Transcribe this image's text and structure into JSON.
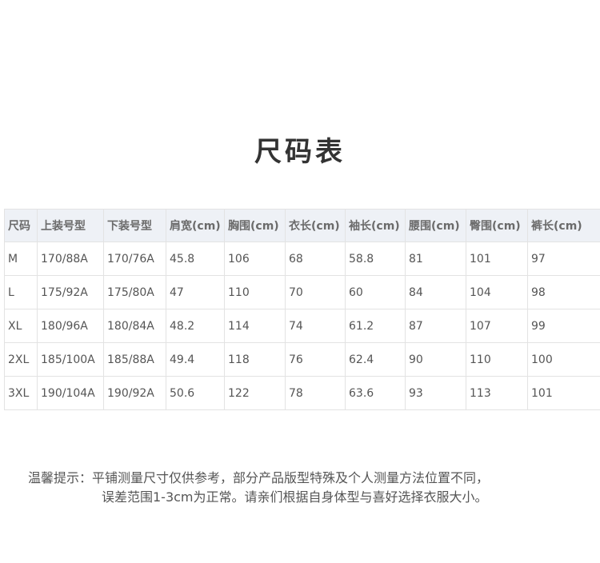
{
  "title": "尺码表",
  "table": {
    "headers": [
      "尺码",
      "上装号型",
      "下装号型",
      "肩宽(cm)",
      "胸围(cm)",
      "衣长(cm)",
      "袖长(cm)",
      "腰围(cm)",
      "臀围(cm)",
      "裤长(cm)"
    ],
    "rows": [
      [
        "M",
        "170/88A",
        "170/76A",
        "45.8",
        "106",
        "68",
        "58.8",
        "81",
        "101",
        "97"
      ],
      [
        "L",
        "175/92A",
        "175/80A",
        "47",
        "110",
        "70",
        "60",
        "84",
        "104",
        "98"
      ],
      [
        "XL",
        "180/96A",
        "180/84A",
        "48.2",
        "114",
        "74",
        "61.2",
        "87",
        "107",
        "99"
      ],
      [
        "2XL",
        "185/100A",
        "185/88A",
        "49.4",
        "118",
        "76",
        "62.4",
        "90",
        "110",
        "100"
      ],
      [
        "3XL",
        "190/104A",
        "190/92A",
        "50.6",
        "122",
        "78",
        "63.6",
        "93",
        "113",
        "101"
      ]
    ]
  },
  "tip": {
    "line1": "温馨提示：平铺测量尺寸仅供参考，部分产品版型特殊及个人测量方法位置不同，",
    "line2": "误差范围1-3cm为正常。请亲们根据自身体型与喜好选择衣服大小。"
  }
}
